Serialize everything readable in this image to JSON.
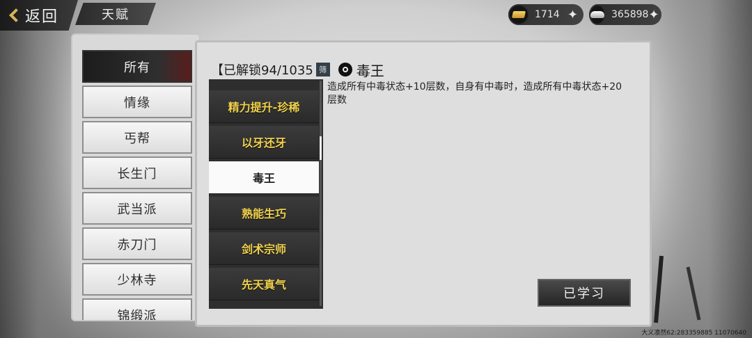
{
  "header": {
    "back_label": "返回",
    "title": "天赋"
  },
  "currencies": {
    "gold": {
      "amount": "1714",
      "icon": "gold-ingot-icon"
    },
    "silver": {
      "amount": "365898",
      "icon": "silver-ingot-icon"
    }
  },
  "categories": [
    {
      "label": "所有",
      "active": true
    },
    {
      "label": "情缘",
      "active": false
    },
    {
      "label": "丐帮",
      "active": false
    },
    {
      "label": "长生门",
      "active": false
    },
    {
      "label": "武当派",
      "active": false
    },
    {
      "label": "赤刀门",
      "active": false
    },
    {
      "label": "少林寺",
      "active": false
    },
    {
      "label": "锦缎派",
      "active": false
    }
  ],
  "talent": {
    "unlock_text": "【已解锁94/1035",
    "filter_label": "筛",
    "selected_name": "毒王",
    "description": "造成所有中毒状态+10层数，自身有中毒时，造成所有中毒状态+20层数"
  },
  "skills": [
    {
      "label": "精力提升-珍稀",
      "active": false
    },
    {
      "label": "以牙还牙",
      "active": false
    },
    {
      "label": "毒王",
      "active": true
    },
    {
      "label": "熟能生巧",
      "active": false
    },
    {
      "label": "剑术宗师",
      "active": false
    },
    {
      "label": "先天真气",
      "active": false
    }
  ],
  "learned_button": "已学习",
  "watermark": "大义凛然62:283359885 11070640",
  "colors": {
    "skill_text": "#f1d24d",
    "gold_accent": "#d7b45a"
  }
}
